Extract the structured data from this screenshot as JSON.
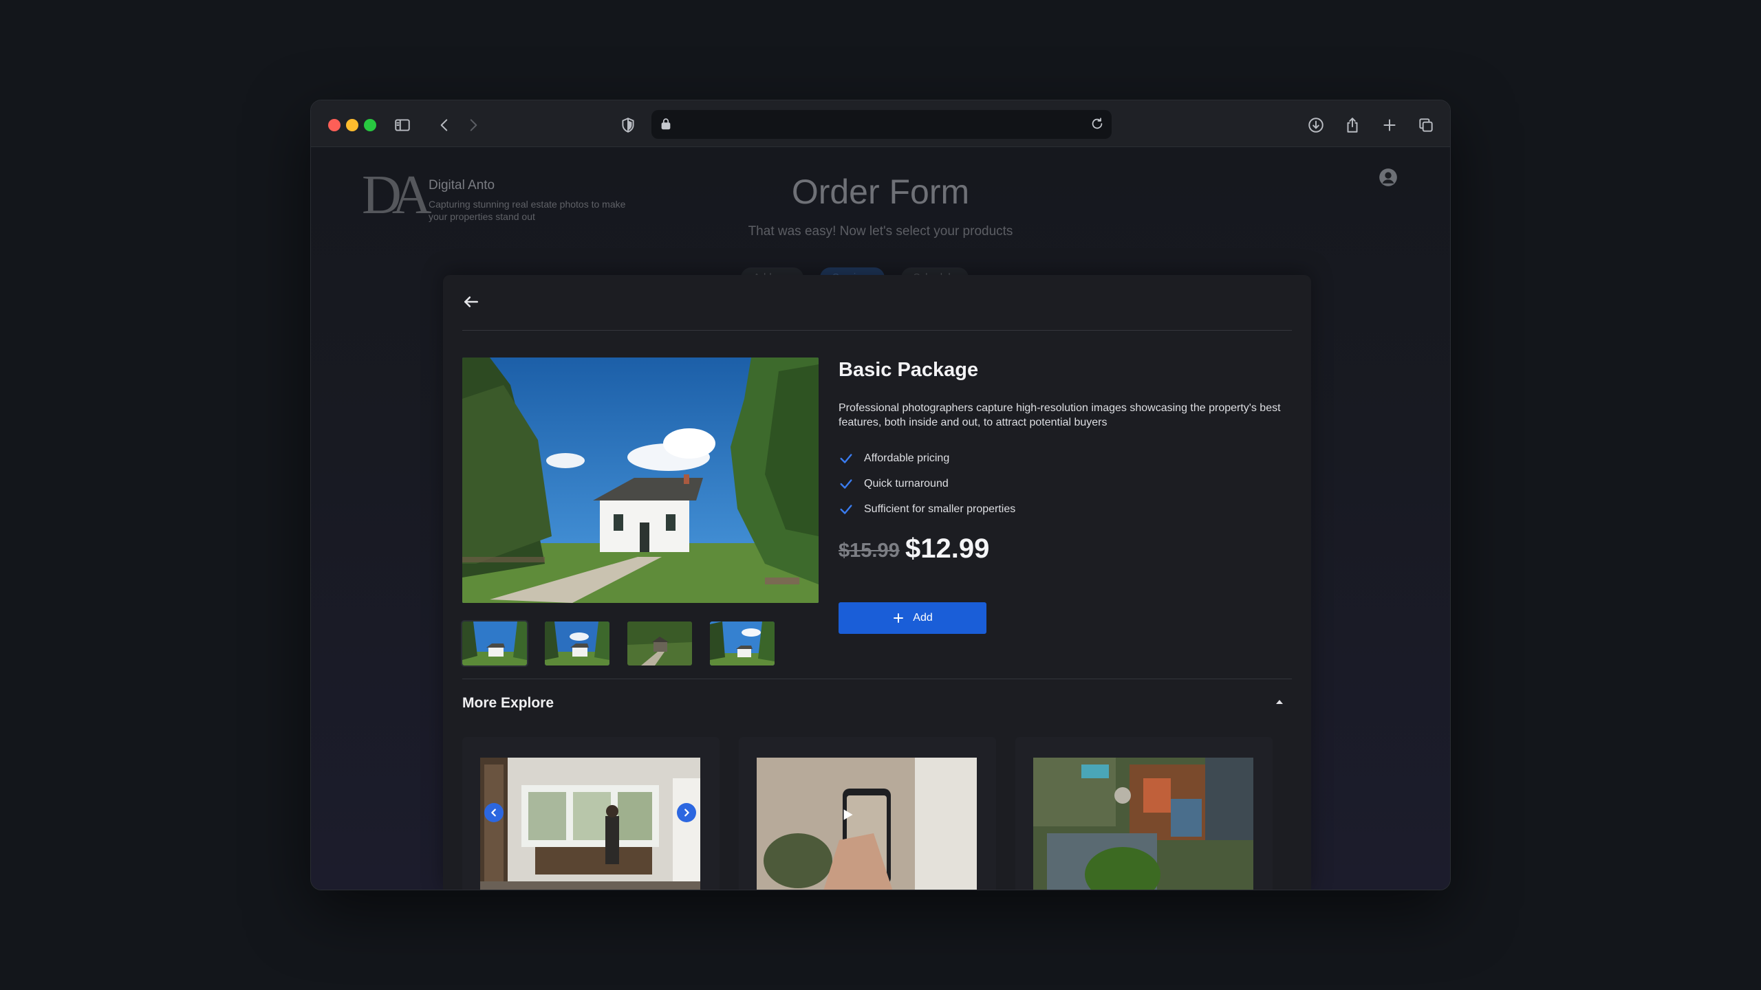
{
  "brand": {
    "logo_text": "DA",
    "name": "Digital Anto",
    "tagline": "Capturing stunning real estate photos to make your properties stand out"
  },
  "header": {
    "title": "Order Form",
    "subtitle": "That was easy! Now let's select your products"
  },
  "steps": [
    {
      "label": "Address"
    },
    {
      "label": "Services"
    },
    {
      "label": "Schedule"
    }
  ],
  "product": {
    "title": "Basic Package",
    "description": "Professional photographers capture high-resolution images showcasing the property's best features, both inside and out, to attract potential buyers",
    "features": [
      "Affordable pricing",
      "Quick turnaround",
      "Sufficient for smaller properties"
    ],
    "price_original": "$15.99",
    "price_current": "$12.99",
    "add_label": "Add"
  },
  "more": {
    "title": "More Explore"
  },
  "colors": {
    "accent": "#1a5ed8",
    "check": "#3a7cf0",
    "background": "#13161b"
  },
  "icons": [
    "sidebar-icon",
    "back-icon",
    "forward-icon",
    "shield-icon",
    "lock-icon",
    "reload-icon",
    "download-icon",
    "share-icon",
    "plus-icon",
    "tabs-icon",
    "user-icon",
    "arrow-left-icon",
    "check-icon",
    "chevron-up-icon",
    "play-icon"
  ]
}
